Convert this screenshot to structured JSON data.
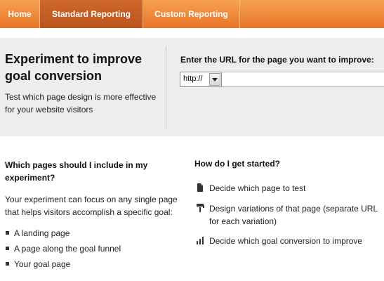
{
  "nav": {
    "tabs": [
      {
        "label": "Home"
      },
      {
        "label": "Standard Reporting"
      },
      {
        "label": "Custom Reporting"
      }
    ],
    "active_tab": "Standard Reporting",
    "accent_color": "#e8752a"
  },
  "header": {
    "title": "Experiment to improve goal conversion",
    "description": "Test which page design is more effective for your website visitors"
  },
  "url_form": {
    "label": "Enter the URL for the page you want to improve:",
    "protocol_selected": "http://",
    "url_value": ""
  },
  "left": {
    "heading": "Which pages should I include in my experiment?",
    "body": "Your experiment can focus on any single page that helps visitors accomplish a specific goal:",
    "bullets": [
      "A landing page",
      "A page along the goal funnel",
      "Your goal page"
    ]
  },
  "right": {
    "heading": "How do I get started?",
    "steps": [
      {
        "text": "Decide which page to test",
        "icon": "page-icon"
      },
      {
        "text": "Design variations of that page (separate URL for each variation)",
        "icon": "paint-roller-icon"
      },
      {
        "text": "Decide which goal conversion to improve",
        "icon": "bar-chart-icon"
      }
    ]
  }
}
